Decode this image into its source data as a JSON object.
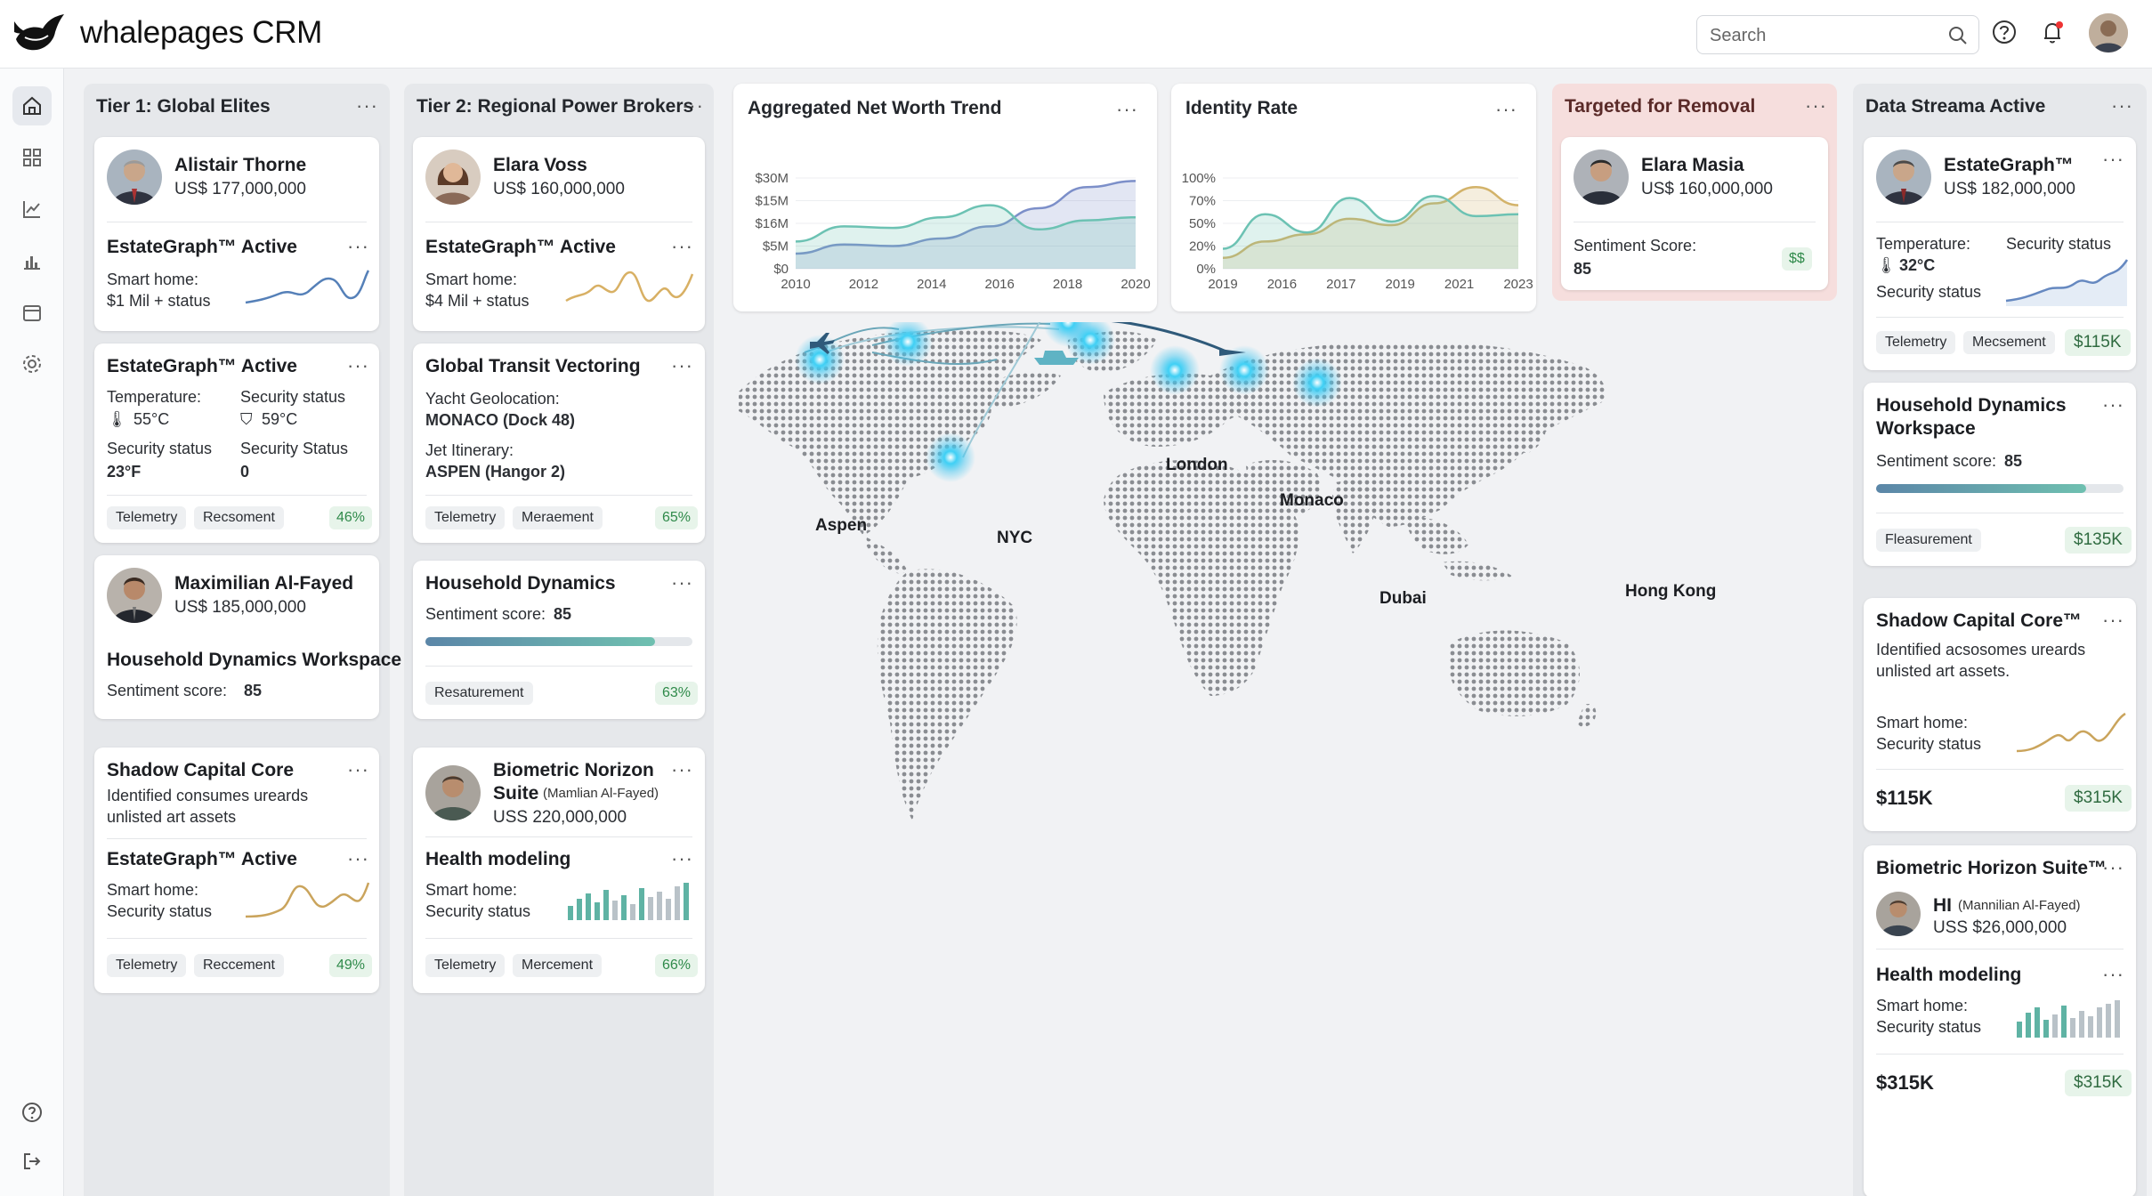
{
  "app": {
    "title": "whalepages CRM"
  },
  "topbar": {
    "search_placeholder": "Search"
  },
  "columns": {
    "tier1": {
      "title": "Tier 1: Global Elites",
      "c1": {
        "name": "Alistair Thorne",
        "amount": "US$ 177,000,000",
        "section": "EstateGraph™ Active",
        "line1": "Smart home:",
        "line2": "$1 Mil + status"
      },
      "c2": {
        "title": "EstateGraph™ Active",
        "temp_label": "Temperature:",
        "temp_value": "55°C",
        "sec_label": "Security status",
        "sec_value": "59°C",
        "sec2_label": "Security status",
        "sec2_value": "23°F",
        "sec3_label": "Security Status",
        "sec3_value": "0",
        "tag1": "Telemetry",
        "tag2": "Recsoment",
        "pct": "46%"
      },
      "c3": {
        "name": "Maximilian Al-Fayed",
        "amount": "US$ 185,000,000",
        "section": "Household Dynamics Workspace",
        "sentiment_label": "Sentiment score:",
        "sentiment_value": "85"
      },
      "c4": {
        "title": "Shadow Capital Core",
        "desc1": "Identified consumes ureards",
        "desc2": "unlisted art assets",
        "section": "EstateGraph™ Active",
        "line1": "Smart home:",
        "line2": "Security status",
        "tag1": "Telemetry",
        "tag2": "Reccement",
        "pct": "49%"
      }
    },
    "tier2": {
      "title": "Tier 2: Regional Power Brokers",
      "c1": {
        "name": "Elara Voss",
        "amount": "US$ 160,000,000",
        "section": "EstateGraph™ Active",
        "line1": "Smart home:",
        "line2": "$4 Mil + status"
      },
      "c2": {
        "title": "Global Transit Vectoring",
        "l1": "Yacht Geolocation:",
        "v1": "MONACO (Dock 48)",
        "l2": "Jet Itinerary:",
        "v2": "ASPEN (Hangor 2)",
        "tag1": "Telemetry",
        "tag2": "Meraement",
        "pct": "65%"
      },
      "c3": {
        "title": "Household Dynamics",
        "sentiment_label": "Sentiment score:",
        "sentiment_value": "85",
        "sentiment_fill": 0.86,
        "tag1": "Resaturement",
        "pct": "63%"
      },
      "c4": {
        "name1": "Biometric Norizon",
        "name2": "Suite",
        "name_note": "(Mamlian Al-Fayed)",
        "amount": "USS 220,000,000",
        "section": "Health modeling",
        "line1": "Smart home:",
        "line2": "Security status",
        "tag1": "Telemetry",
        "tag2": "Mercement",
        "pct": "66%"
      }
    },
    "removal": {
      "title": "Targeted for Removal",
      "c1": {
        "name": "Elara Masia",
        "amount": "US$ 160,000,000",
        "sentiment_label": "Sentiment Score:",
        "sentiment_value": "85",
        "badge": "$$"
      }
    },
    "data": {
      "title": "Data Streama Active",
      "c1": {
        "name": "EstateGraph™",
        "amount": "US$ 182,000,000",
        "temp_label": "Temperature:",
        "temp_value": "32°C",
        "sec_label": "Security status",
        "sec2_label": "Security status",
        "tag1": "Telemetry",
        "tag2": "Mecsement",
        "money": "$115K"
      },
      "c2": {
        "title1": "Household Dynamics",
        "title2": "Workspace",
        "sentiment_label": "Sentiment score:",
        "sentiment_value": "85",
        "sentiment_fill": 0.85,
        "tag1": "Fleasurement",
        "money": "$135K"
      },
      "c3": {
        "title": "Shadow Capital Core™",
        "desc1": "Identified acsosomes ureards",
        "desc2": "unlisted art assets.",
        "line1": "Smart home:",
        "line2": "Security status",
        "value": "$115K",
        "money": "$315K"
      },
      "c4": {
        "title": "Biometric Horizon Suite™",
        "name": "HI",
        "name_note": "(Mannilian Al-Fayed)",
        "amount": "USS $26,000,000",
        "section": "Health modeling",
        "line1": "Smart home:",
        "line2": "Security status",
        "value": "$315K",
        "money": "$315K"
      }
    }
  },
  "charts": {
    "networth": {
      "title": "Aggregated Net Worth Trend"
    },
    "identity": {
      "title": "Identity Rate"
    }
  },
  "chart_data": [
    {
      "type": "area",
      "title": "Aggregated Net Worth Trend",
      "x": [
        "2010",
        "2012",
        "2014",
        "2016",
        "2018",
        "2020"
      ],
      "yticks": [
        "$30M",
        "$15M",
        "$16M",
        "$5M",
        "$0"
      ],
      "ylim": [
        0,
        30
      ],
      "series": [
        {
          "color": "#7c8fc9",
          "values": [
            5,
            8,
            7.5,
            10,
            14,
            20,
            27,
            29
          ]
        },
        {
          "color": "#6cc2b3",
          "values": [
            9,
            14,
            13.5,
            17,
            21,
            13,
            16,
            17
          ]
        }
      ]
    },
    {
      "type": "area",
      "title": "Identity Rate",
      "x": [
        "2019",
        "2016",
        "2017",
        "2019",
        "2021",
        "2023"
      ],
      "yticks": [
        "100%",
        "70%",
        "50%",
        "20%",
        "0%"
      ],
      "ylim": [
        0,
        100
      ],
      "series": [
        {
          "color": "#d3b36a",
          "values": [
            12,
            30,
            38,
            55,
            48,
            72,
            90,
            70
          ]
        },
        {
          "color": "#6cc2b3",
          "values": [
            22,
            60,
            40,
            78,
            52,
            80,
            58,
            60
          ]
        }
      ]
    }
  ],
  "map": {
    "labels": {
      "aspen": "Aspen",
      "nyc": "NYC",
      "london": "London",
      "monaco": "Monaco",
      "dubai": "Dubai",
      "hongkong": "Hong Kong"
    }
  }
}
